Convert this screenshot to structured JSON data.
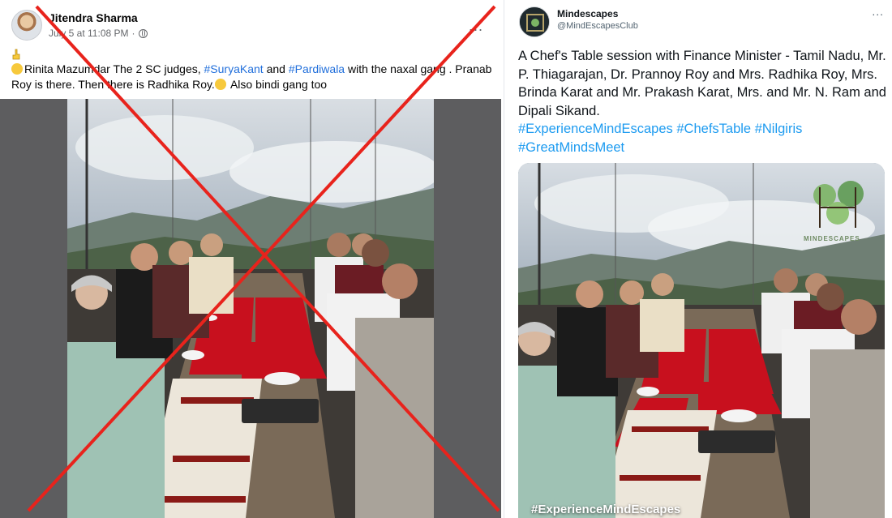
{
  "facebook_post": {
    "author": "Jitendra Sharma",
    "timestamp": "July 5 at 11:08 PM",
    "separator": "·",
    "more": "...",
    "text": {
      "p1": "Rinita Mazumdar The 2 SC judges, ",
      "tag1": "#SuryaKant",
      "p2": " and ",
      "tag2": "#Pardiwala",
      "p3": " with the naxal gang . Pranab Roy is there. Then there is Radhika Roy.",
      "p4": " Also bindi gang too"
    },
    "overlay": "red-x-cross"
  },
  "tweet": {
    "account_name": "Mindescapes",
    "handle": "@MindEscapesClub",
    "more": "...",
    "text": "A Chef's Table session with Finance Minister - Tamil Nadu, Mr. P. Thiagarajan, Dr. Prannoy Roy and Mrs. Radhika Roy, Mrs. Brinda Karat and Mr. Prakash Karat, Mrs. and Mr. N. Ram and Dipali Sikand.",
    "hashtags": [
      "#ExperienceMindEscapes",
      "#ChefsTable",
      "#Nilgiris",
      "#GreatMindsMeet"
    ],
    "logo_text": "MINDESCAPES",
    "watermark": "#ExperienceMindEscapes"
  },
  "colors": {
    "facebook_hashtag": "#216fdb",
    "twitter_hashtag": "#1d9bf0",
    "cross": "#e8231c",
    "table_runner": "#c8101e"
  }
}
